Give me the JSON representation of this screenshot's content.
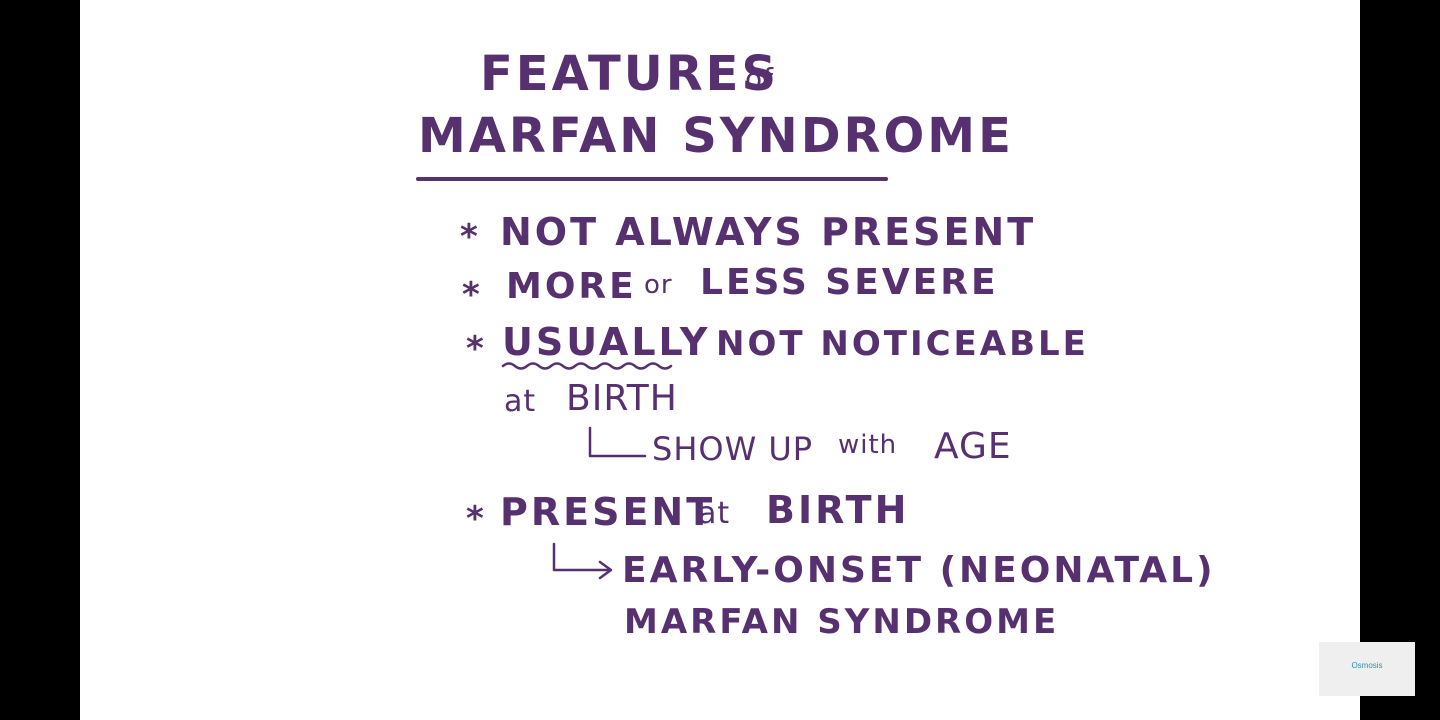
{
  "slide": {
    "title_line1_main": "FEATURES",
    "title_line1_small": "of",
    "title_line2": "MARFAN SYNDROME",
    "bullets": [
      {
        "main": "NOT ALWAYS PRESENT"
      },
      {
        "part1": "MORE",
        "small": "or",
        "part2": "LESS SEVERE"
      },
      {
        "emph": "USUALLY",
        "rest": "NOT NOTICEABLE",
        "line2_small": "at",
        "line2_main": "BIRTH"
      },
      {
        "main": "PRESENT",
        "small": "at",
        "main2": "BIRTH"
      }
    ],
    "sub_age_part1": "SHOW UP",
    "sub_age_small": "with",
    "sub_age_part2": "AGE",
    "sub_early_line1": "EARLY-ONSET (NEONATAL)",
    "sub_early_line2": "MARFAN SYNDROME",
    "bullet_symbol": "*"
  },
  "watermark": {
    "logo_text": "Osmosis"
  },
  "colors": {
    "ink": "#57306f",
    "background": "#ffffff",
    "letterbox": "#000000"
  }
}
